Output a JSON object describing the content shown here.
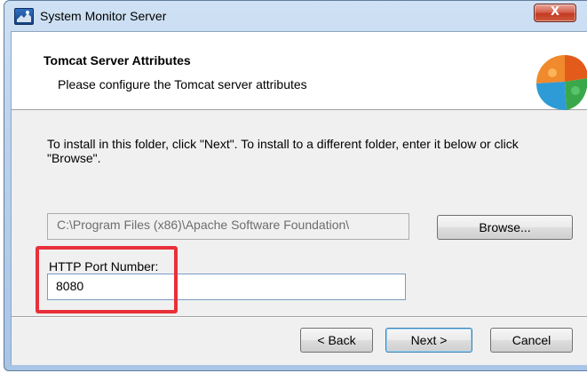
{
  "window": {
    "title": "System Monitor Server",
    "close_label": "X"
  },
  "header": {
    "title": "Tomcat Server Attributes",
    "subtitle": "Please configure the Tomcat server attributes"
  },
  "main": {
    "instruction": "To install in this folder, click \"Next\". To install to a different folder, enter it below or click \"Browse\".",
    "path_value": "C:\\Program Files (x86)\\Apache Software Foundation\\",
    "browse_label": "Browse...",
    "port_label": "HTTP Port Number:",
    "port_value": "8080"
  },
  "footer": {
    "back_label": "< Back",
    "next_label": "Next >",
    "cancel_label": "Cancel"
  },
  "colors": {
    "highlight": "#e8303a",
    "title_gradient_top": "#cfe1f4",
    "client_bg": "#f0f0f0"
  },
  "icons": {
    "app": "server-monitor-icon",
    "header": "tomcat-puzzle-icon",
    "close": "close-icon"
  }
}
